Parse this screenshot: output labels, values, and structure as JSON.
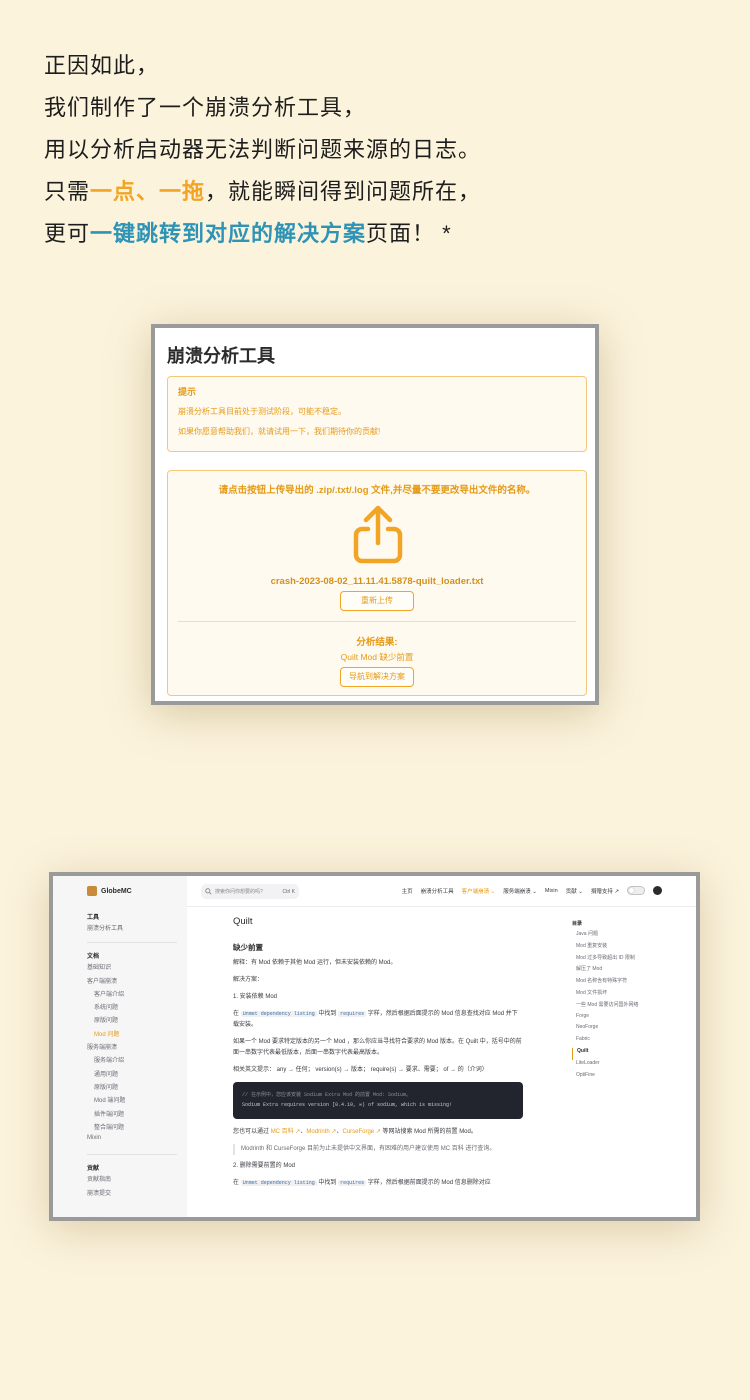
{
  "intro": {
    "line1": "正因如此，",
    "line2": "我们制作了一个崩溃分析工具，",
    "line3": "用以分析启动器无法判断问题来源的日志。",
    "line4_pre": "只需",
    "line4_hl": "一点、一拖",
    "line4_post": "，就能瞬间得到问题所在，",
    "line5_pre": "更可",
    "line5_hl": "一键跳转到对应的解决方案",
    "line5_post": "页面！ *"
  },
  "crash_tool": {
    "title": "崩溃分析工具",
    "tip_heading": "提示",
    "tip_line1": "崩溃分析工具目前处于测试阶段，可能不稳定。",
    "tip_line2": "如果你愿意帮助我们，就请试用一下，我们期待你的贡献!",
    "upload_instruction": "请点击按钮上传导出的 .zip/.txt/.log 文件,并尽量不要更改导出文件的名称。",
    "upload_icon": "share-upload-icon",
    "filename": "crash-2023-08-02_11.11.41.5878-quilt_loader.txt",
    "reupload_label": "重新上传",
    "result_heading": "分析结果:",
    "result_text": "Quilt Mod 缺少前置",
    "navigate_label": "导航到解决方案",
    "accent_color": "#f2a424"
  },
  "docs": {
    "site_name": "GlobeMC",
    "search_placeholder": "搜索你问你想要的吗?",
    "search_shortcut": "Ctrl K",
    "nav": [
      "主页",
      "崩溃分析工具",
      "客户端崩溃 ⌄",
      "服务端崩溃 ⌄",
      "Mixin",
      "贡献 ⌄",
      "捐赠支持 ↗"
    ],
    "sidebar": {
      "tools_heading": "工具",
      "tools_items": [
        "崩溃分析工具"
      ],
      "docs_heading": "文档",
      "docs_items": [
        "基础知识",
        "客户端崩溃"
      ],
      "client_sub": [
        "客户端介绍",
        "系统问题",
        "原版问题",
        "Mod 问题"
      ],
      "server_item": "服务端崩溃",
      "server_sub": [
        "服务端介绍",
        "通用问题",
        "原版问题",
        "Mod 端问题",
        "插件端问题",
        "整合端问题"
      ],
      "mixin_item": "Mixin",
      "contrib_heading": "贡献",
      "contrib_items": [
        "贡献指南",
        "崩溃提交"
      ]
    },
    "page_title": "Quilt",
    "section_title": "缺少前置",
    "explain": "解释：有 Mod 依赖于其他 Mod 运行，但未安装依赖的 Mod。",
    "solution_label": "解决方案：",
    "step1": "1. 安装依赖 Mod",
    "p1_pre": "在",
    "p1_code1": "Unmet dependency listing",
    "p1_mid": "中找到",
    "p1_code2": "requires",
    "p1_post": "字样，然后根据后面提示的 Mod 信息查找对应 Mod 并下载安装。",
    "p2": "如果一个 Mod 要求特定版本的另一个 Mod ，那么你应当寻找符合要求的 Mod 版本。在 Quilt 中，括号中的前面一串数字代表最低版本，后面一串数字代表最高版本。",
    "p3": "相关英文提示： any → 任何； version(s) → 版本； require(s) → 要求、需要； of → 的（介词）",
    "code_comment": "// 在示例中，您应该安装 Sodium Extra Mod 的前置 Mod: Sodium。",
    "code_line": "Sodium Extra requires version [0.4.10, ∞) of sodium, which is missing!",
    "p4_pre": "您也可以通过",
    "p4_link1": "MC 百科 ↗",
    "p4_link2": "Modrinth ↗",
    "p4_link3": "CurseForge ↗",
    "p4_post": "等网站搜索 Mod 所需的前置 Mod。",
    "quote": "Modrinth 和 CurseForge 目前为止未提供中文界面，有困难的用户建议使用 MC 百科 进行查询。",
    "step2": "2. 删除需要前置的 Mod",
    "p5_pre": "在",
    "p5_code1": "Unmet dependency listing",
    "p5_mid": "中找到",
    "p5_code2": "requires",
    "p5_post": "字样，然后根据前面提示的 Mod 信息删除对应",
    "toc_heading": "目录",
    "toc": [
      "Java 问题",
      "Mod 重复安装",
      "Mod 过多导致超出 ID 限制",
      "解压了 Mod",
      "Mod 名称含有特殊字符",
      "Mod 文件损坏",
      "一些 Mod 需要访问国外网络",
      "Forge",
      "NeoForge",
      "Fabric",
      "Quilt",
      "LiteLoader",
      "OptiFine"
    ],
    "toc_active": "Quilt"
  }
}
